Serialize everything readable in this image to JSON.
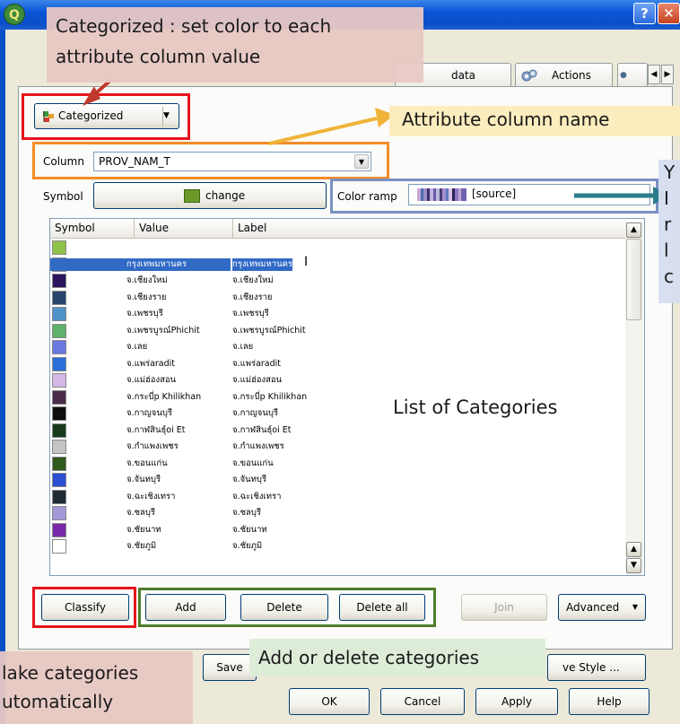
{
  "window": {
    "help_glyph": "?",
    "close_glyph": "✕",
    "app_glyph": "Q"
  },
  "tabs": {
    "metadata_label": "data",
    "actions_label": "Actions"
  },
  "renderer": {
    "selected": "Categorized",
    "column_label": "Column",
    "column_value": "PROV_NAM_T",
    "symbol_label": "Symbol",
    "symbol_change": "change",
    "color_ramp_label": "Color ramp",
    "color_ramp_value": "[source]"
  },
  "table": {
    "headers": [
      "Symbol",
      "Value",
      "Label"
    ],
    "rows": [
      {
        "color": "#8ec24a",
        "value": "",
        "label": ""
      },
      {
        "color": "#8fbcc1",
        "value": "กรุงเทพมหานคร",
        "label": "กรุงเทพมหานคร",
        "selected": true
      },
      {
        "color": "#2b1560",
        "value": "จ.เชียงใหม่",
        "label": "จ.เชียงใหม่"
      },
      {
        "color": "#28456e",
        "value": "จ.เชียงราย",
        "label": "จ.เชียงราย"
      },
      {
        "color": "#4f92c8",
        "value": "จ.เพชรบุรี",
        "label": "จ.เพชรบุรี"
      },
      {
        "color": "#5fb06a",
        "value": "จ.เพชรบูรณ์Phichit",
        "label": "จ.เพชรบูรณ์Phichit"
      },
      {
        "color": "#6a78e0",
        "value": "จ.เลย",
        "label": "จ.เลย"
      },
      {
        "color": "#2a6fd8",
        "value": "จ.แพร่aradit",
        "label": "จ.แพร่aradit"
      },
      {
        "color": "#d5b7e8",
        "value": "จ.แม่ฮ่องสอน",
        "label": "จ.แม่ฮ่องสอน"
      },
      {
        "color": "#4a2c48",
        "value": "จ.กระบี่p Khilikhan",
        "label": "จ.กระบี่p Khilikhan"
      },
      {
        "color": "#0d0d0d",
        "value": "จ.กาญจนบุรี",
        "label": "จ.กาญจนบุรี"
      },
      {
        "color": "#173a1c",
        "value": "จ.กาฬสินธุ์oi Et",
        "label": "จ.กาฬสินธุ์oi Et"
      },
      {
        "color": "#c4c4c4",
        "value": "จ.กำแพงเพชร",
        "label": "จ.กำแพงเพชร"
      },
      {
        "color": "#2f5a1e",
        "value": "จ.ขอนแก่น",
        "label": "จ.ขอนแก่น"
      },
      {
        "color": "#2a4fd0",
        "value": "จ.จันทบุรี",
        "label": "จ.จันทบุรี"
      },
      {
        "color": "#1e2c36",
        "value": "จ.ฉะเชิงเทรา",
        "label": "จ.ฉะเชิงเทรา"
      },
      {
        "color": "#a497d8",
        "value": "จ.ชลบุรี",
        "label": "จ.ชลบุรี"
      },
      {
        "color": "#7828a8",
        "value": "จ.ชัยนาท",
        "label": "จ.ชัยนาท"
      },
      {
        "color": "#ffffff",
        "value": "จ.ชัยภูมิ",
        "label": "จ.ชัยภูมิ"
      }
    ]
  },
  "buttons": {
    "classify": "Classify",
    "add": "Add",
    "delete": "Delete",
    "delete_all": "Delete all",
    "join": "Join",
    "advanced": "Advanced",
    "save": "Save",
    "save_style": "ve Style ...",
    "ok": "OK",
    "cancel": "Cancel",
    "apply": "Apply",
    "help": "Help"
  },
  "annotations": {
    "categorized_note": "Categorized : set color to each attribute column value",
    "attribute_column_name": "Attribute column name",
    "color_ramp_note_lines": [
      "Y",
      "I",
      "r",
      "l",
      "c"
    ],
    "list_of_categories": "List of Categories",
    "add_delete_note": "Add or delete categories",
    "classify_note": "lake categories utomatically"
  },
  "colors": {
    "red_box": "#e8141b",
    "orange_box": "#f28c28",
    "blue_box": "#7a90c2",
    "green_box": "#4e7d2a",
    "orange_arrow": "#f0b43a",
    "teal_arrow": "#2a7d8c",
    "red_arrow": "#c0392b"
  }
}
